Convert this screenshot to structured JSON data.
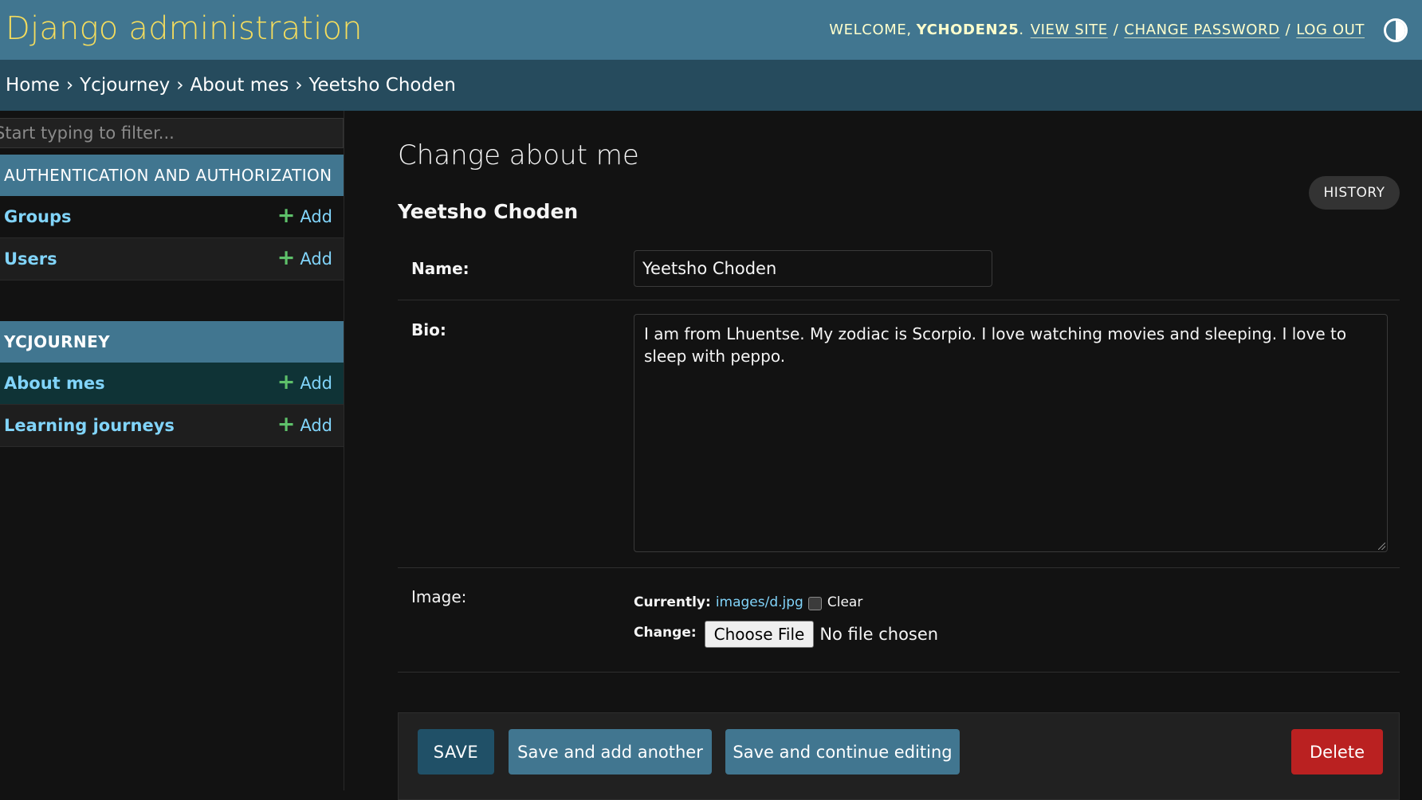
{
  "header": {
    "site_title": "Django administration",
    "welcome": "Welcome,",
    "username": "ychoden25",
    "username_suffix": ".",
    "view_site": "View site",
    "change_password": "Change password",
    "log_out": "Log out",
    "separator": "/",
    "theme_icon": "theme-toggle-icon"
  },
  "breadcrumbs": {
    "items": [
      "Home",
      "Ycjourney",
      "About mes",
      "Yeetsho Choden"
    ],
    "separator": "›"
  },
  "sidebar": {
    "filter_placeholder": "Start typing to filter...",
    "apps": [
      {
        "caption": "AUTHENTICATION AND AUTHORIZATION",
        "models": [
          {
            "name": "Groups",
            "add": "Add"
          },
          {
            "name": "Users",
            "add": "Add"
          }
        ]
      },
      {
        "caption": "YCJOURNEY",
        "models": [
          {
            "name": "About mes",
            "add": "Add",
            "selected": true
          },
          {
            "name": "Learning journeys",
            "add": "Add"
          }
        ]
      }
    ]
  },
  "main": {
    "page_title": "Change about me",
    "object_title": "Yeetsho Choden",
    "history_button": "HISTORY",
    "fields": {
      "name": {
        "label": "Name:",
        "value": "Yeetsho Choden"
      },
      "bio": {
        "label": "Bio:",
        "value": "I am from Lhuentse. My zodiac is Scorpio. I love watching movies and sleeping. I love to sleep with peppo."
      },
      "image": {
        "label": "Image:",
        "currently_label": "Currently:",
        "current_file": "images/d.jpg",
        "clear_label": "Clear",
        "change_label": "Change:",
        "choose_button": "Choose File",
        "no_file": "No file chosen"
      }
    },
    "buttons": {
      "save": "SAVE",
      "save_add_another": "Save and add another",
      "save_continue": "Save and continue editing",
      "delete": "Delete"
    }
  },
  "colors": {
    "header_bg": "#417690",
    "breadcrumbs_bg": "#264b5d",
    "accent_yellow": "#f5dd5d",
    "link_blue": "#81d4fa",
    "delete_red": "#ba2121",
    "body_bg": "#121212"
  }
}
